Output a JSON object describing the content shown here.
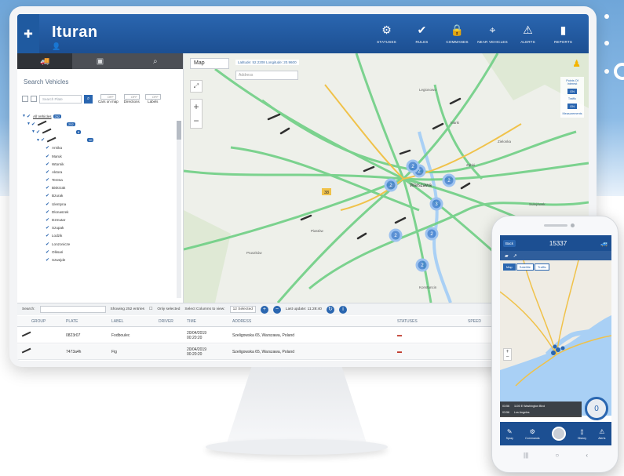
{
  "app": {
    "brand": "Ituran",
    "nav": [
      {
        "label": "STATUSES",
        "icon": "statuses-icon",
        "glyph": "⚙"
      },
      {
        "label": "RULES",
        "icon": "rules-icon",
        "glyph": "✔"
      },
      {
        "label": "COMMANDS",
        "icon": "commands-icon",
        "glyph": "🔒"
      },
      {
        "label": "NEAR VEHICLES",
        "icon": "near-vehicles-icon",
        "glyph": "⌖"
      },
      {
        "label": "ALERTS",
        "icon": "alerts-icon",
        "glyph": "⚠"
      },
      {
        "label": "REPORTS",
        "icon": "reports-icon",
        "glyph": "▮"
      }
    ]
  },
  "sidebar": {
    "title": "Search Vehicles",
    "search_placeholder": "Search Plate",
    "toggles": [
      {
        "state": "OFF",
        "label": "Cars on map"
      },
      {
        "state": "OFF",
        "label": "Directions"
      },
      {
        "state": "OFF",
        "label": "Labels"
      }
    ],
    "root": {
      "label": "All Vehicles",
      "count": "252"
    },
    "group_count_1": "252",
    "group_badge_2": "8",
    "group_badge_3": "10",
    "vehicles": [
      "Arnika",
      "Maruk",
      "Wtornik",
      "Aktora",
      "Teresa",
      "Biskrzak",
      "Bzurak",
      "Ulentyna",
      "Dlonaszek",
      "Dzmutar",
      "Szupak",
      "Lodzik",
      "Lonzonicze",
      "Olksari",
      "Szwejde"
    ]
  },
  "map": {
    "type_select": "Map",
    "coords": "Latitude: 52.2208  Longitude: 20.9600",
    "search_placeholder": "Address",
    "right_panel": [
      {
        "label": "Points Of Interest",
        "state": "ON"
      },
      {
        "label": "Traffic",
        "state": "ON"
      },
      {
        "label": "Measurements",
        "state": ""
      }
    ],
    "clusters": [
      "2",
      "2",
      "2",
      "3",
      "2",
      "2",
      "2",
      "2"
    ],
    "cluster_yellow": "38",
    "labels": [
      {
        "text": "Warszawa"
      },
      {
        "text": "Piastów"
      },
      {
        "text": "Zielonka"
      },
      {
        "text": "Sulejówek"
      },
      {
        "text": "Legionowo"
      },
      {
        "text": "Ząbki"
      },
      {
        "text": "Marki"
      },
      {
        "text": "Pruszków"
      },
      {
        "text": "Konstancin"
      },
      {
        "text": "Otwock"
      }
    ]
  },
  "table": {
    "search_label": "Search:",
    "showing_text": "Showing 252 entries",
    "only_selected": "Only selected",
    "select_columns_label": "Select Columns to view:",
    "columns_selected": "12 Selected",
    "last_update": "Last update: 11:28:40",
    "headers": [
      "GROUP",
      "PLATE",
      "LABEL",
      "DRIVER",
      "TIME",
      "ADDRESS",
      "STATUSES",
      "SPEED"
    ],
    "rows": [
      {
        "group": "",
        "plate": "0823r07",
        "label": "Fodboulec",
        "driver": "",
        "time": "20/04/2019",
        "time2": "00:20:20",
        "address": "Szeligowska 65, Warszawa, Poland",
        "status": "",
        "speed": ""
      },
      {
        "group": "",
        "plate": "7473a4h",
        "label": "Fig",
        "driver": "",
        "time": "20/04/2019",
        "time2": "00:20:20",
        "address": "Szeligowska 65, Warszawa, Poland",
        "status": "",
        "speed": ""
      }
    ]
  },
  "phone": {
    "back": "Back",
    "title": "15337",
    "map_tabs": [
      "Map",
      "Satellite",
      "Traffic"
    ],
    "info": [
      {
        "time": "03:56",
        "text": "1100 E Washington Blvd"
      },
      {
        "time": "03:56",
        "text": "Los Angeles"
      }
    ],
    "gauge": "0",
    "bottom": [
      {
        "label": "Spray",
        "icon": "spray-icon",
        "glyph": "✎"
      },
      {
        "label": "Commands",
        "icon": "commands-icon",
        "glyph": "⚙"
      },
      {
        "label": "",
        "icon": "center-dial-icon",
        "glyph": ""
      },
      {
        "label": "History",
        "icon": "history-icon",
        "glyph": "▯"
      },
      {
        "label": "Alerts",
        "icon": "alerts-icon",
        "glyph": "⚠"
      }
    ],
    "sys": [
      "|||",
      "○",
      "‹"
    ]
  },
  "colors": {
    "brand_blue": "#1c4f92",
    "accent_blue": "#2a66b0",
    "road_green": "#6fcf85",
    "road_yellow": "#f0c24a"
  }
}
